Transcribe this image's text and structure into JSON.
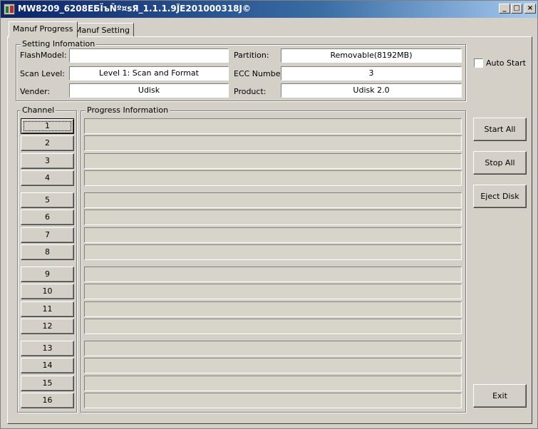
{
  "window": {
    "title": "MW8209_6208ЕБÏъÑº¤sЯ_1.1.1.9J̈E201000318J©",
    "min_glyph": "_",
    "max_glyph": "□",
    "close_glyph": "×"
  },
  "tabs": [
    "Manuf Progress",
    "Manuf Setting"
  ],
  "setting": {
    "group_title": "Setting Infomation",
    "flash_model_label": "FlashModel:",
    "flash_model_value": "",
    "scan_level_label": "Scan Level:",
    "scan_level_value": "Level 1: Scan and Format",
    "vender_label": "Vender:",
    "vender_value": "Udisk",
    "partition_label": "Partition:",
    "partition_value": "Removable(8192MB)",
    "ecc_label": "ECC Number:",
    "ecc_value": "3",
    "product_label": "Product:",
    "product_value": "Udisk 2.0"
  },
  "auto_start": {
    "label": "Auto Start",
    "checked": false
  },
  "channel": {
    "group_title": "Channel",
    "labels": [
      "1",
      "2",
      "3",
      "4",
      "5",
      "6",
      "7",
      "8",
      "9",
      "10",
      "11",
      "12",
      "13",
      "14",
      "15",
      "16"
    ]
  },
  "progress": {
    "group_title": "Progress Information"
  },
  "buttons": {
    "start_all": "Start All",
    "stop_all": "Stop All",
    "eject_disk": "Eject Disk",
    "exit": "Exit"
  }
}
